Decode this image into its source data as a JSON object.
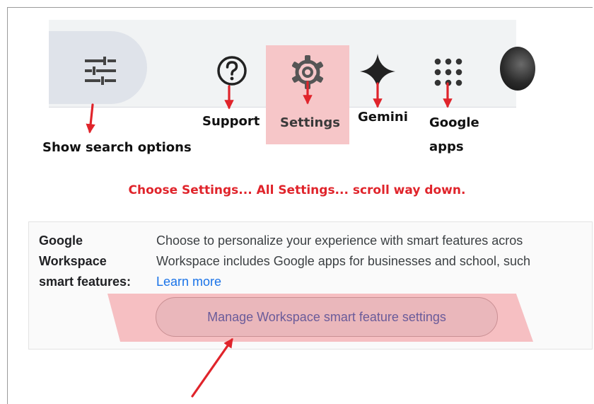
{
  "toolbar": {
    "items": [
      {
        "id": "search-options",
        "icon": "tune-icon",
        "label": "Show search options"
      },
      {
        "id": "support",
        "icon": "help-circle-icon",
        "label": "Support"
      },
      {
        "id": "settings",
        "icon": "gear-icon",
        "label": "Settings"
      },
      {
        "id": "gemini",
        "icon": "sparkle-icon",
        "label": "Gemini"
      },
      {
        "id": "google-apps",
        "icon": "apps-grid-icon",
        "label_line1": "Google",
        "label_line2": "apps"
      }
    ]
  },
  "instruction": "Choose Settings... All Settings... scroll way down.",
  "feature": {
    "label_line1": "Google",
    "label_line2": "Workspace",
    "label_line3": "smart features:",
    "desc_line1": "Choose to personalize your experience with smart features acros",
    "desc_line2": "Workspace includes Google apps for businesses and school, such",
    "learn_more": "Learn more",
    "button": "Manage Workspace smart feature settings"
  },
  "colors": {
    "annotation_red": "#e0242b",
    "highlight_pink": "#f6c6c8",
    "link_blue": "#1a73e8",
    "button_text": "#6a5b9a"
  }
}
